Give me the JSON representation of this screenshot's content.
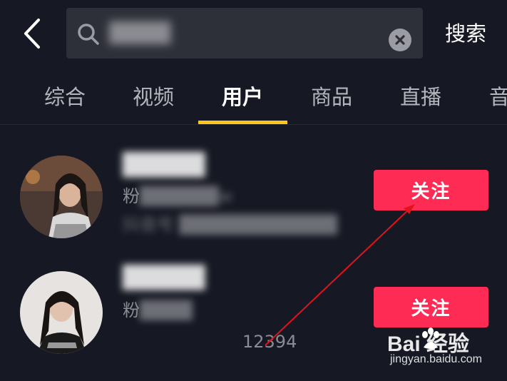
{
  "header": {
    "search_value": "████",
    "search_button": "搜索"
  },
  "tabs": [
    {
      "label": "综合",
      "active": false
    },
    {
      "label": "视频",
      "active": false
    },
    {
      "label": "用户",
      "active": true
    },
    {
      "label": "商品",
      "active": false
    },
    {
      "label": "直播",
      "active": false
    },
    {
      "label": "音",
      "active": false
    }
  ],
  "users": [
    {
      "name": "█████",
      "fans_prefix": "粉",
      "fans_value": "██████w",
      "extra": "抖音号 ████████████"
    },
    {
      "name": "█████",
      "fans_prefix": "粉",
      "fans_value": "████",
      "id_suffix": "12394"
    }
  ],
  "follow_label": "关注",
  "watermark": {
    "brand": "Bai  经验",
    "url": "jingyan.baidu.com"
  },
  "colors": {
    "background": "#161823",
    "accent_underline": "#fdc61b",
    "follow_button": "#fe2c55",
    "annotation_arrow": "#e0141e"
  },
  "icons": [
    "back-arrow-icon",
    "search-icon",
    "clear-icon",
    "paw-icon"
  ]
}
